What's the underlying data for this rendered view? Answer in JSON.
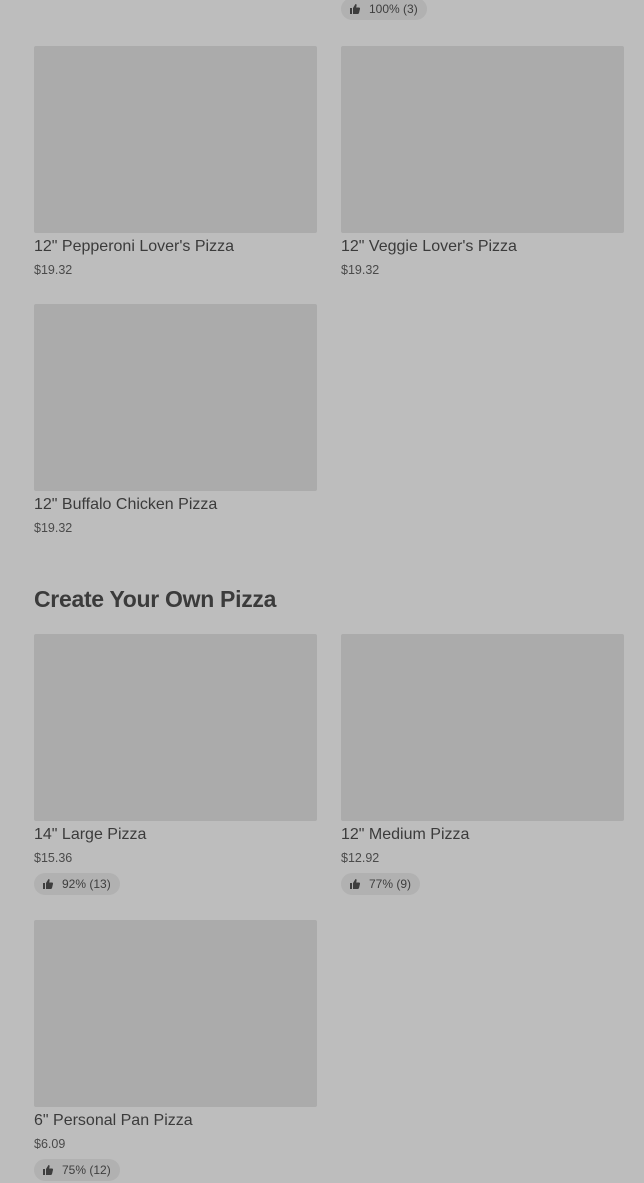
{
  "top_rating": {
    "text": "100% (3)"
  },
  "section_specialty": {
    "items": [
      {
        "name": "12\" Pepperoni Lover's Pizza",
        "price": "$19.32"
      },
      {
        "name": "12\" Veggie Lover's Pizza",
        "price": "$19.32"
      },
      {
        "name": "12\" Buffalo Chicken Pizza",
        "price": "$19.32"
      }
    ]
  },
  "section_create": {
    "title": "Create Your Own Pizza",
    "items": [
      {
        "name": "14\" Large Pizza",
        "price": "$15.36",
        "rating": "92% (13)"
      },
      {
        "name": "12\" Medium Pizza",
        "price": "$12.92",
        "rating": "77% (9)"
      },
      {
        "name": "6\" Personal Pan Pizza",
        "price": "$6.09",
        "rating": "75% (12)"
      }
    ]
  },
  "icons": {
    "rating": "thumbs-up-icon"
  }
}
